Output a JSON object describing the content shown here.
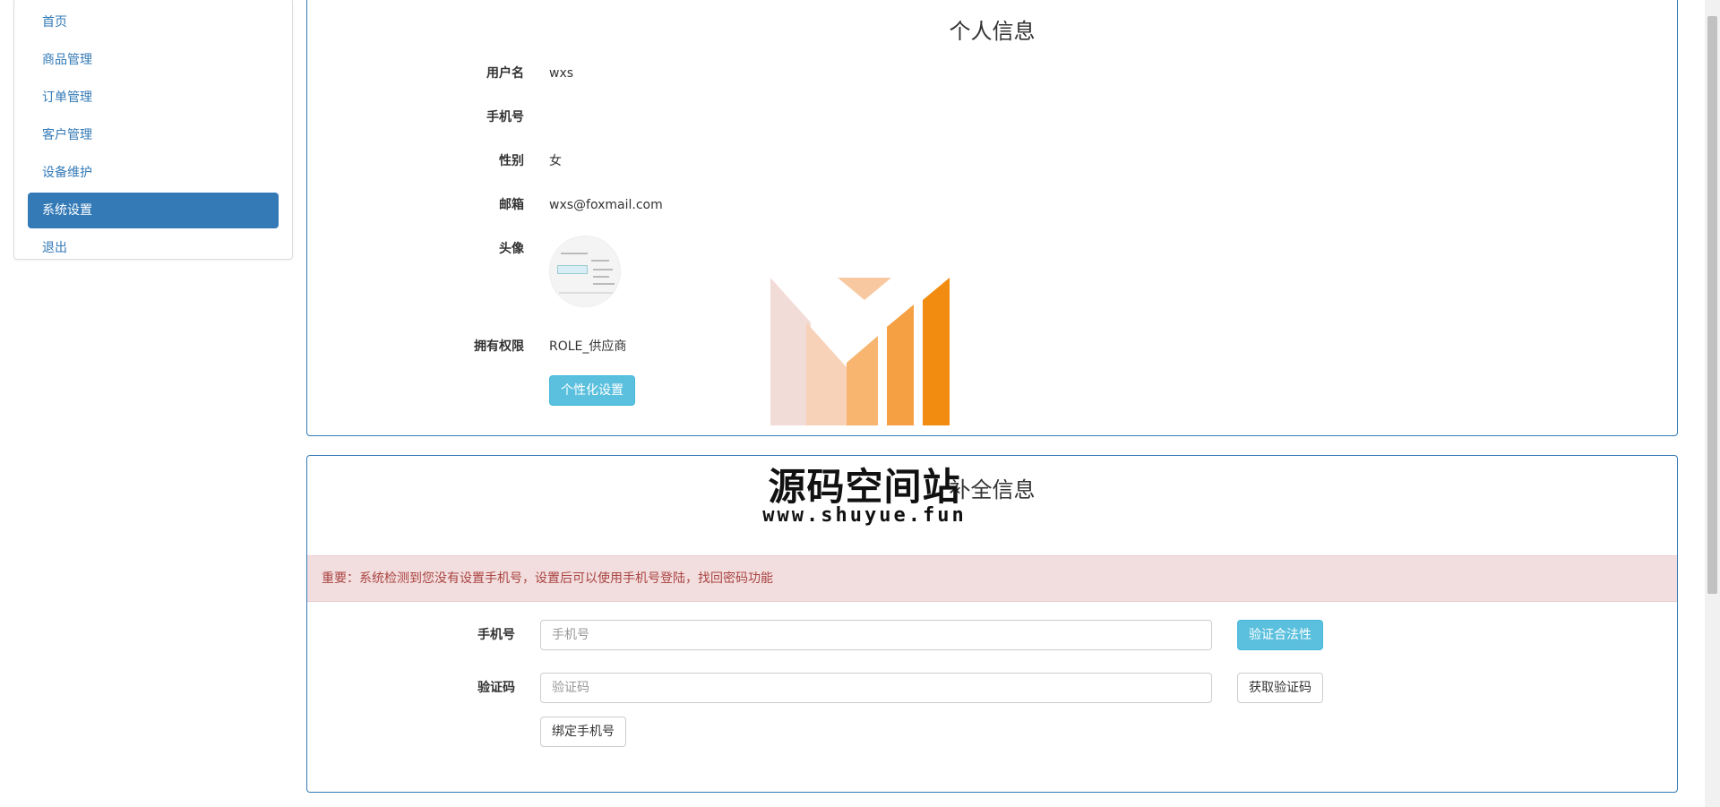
{
  "sidebar": {
    "items": [
      {
        "label": "首页",
        "active": false
      },
      {
        "label": "商品管理",
        "active": false
      },
      {
        "label": "订单管理",
        "active": false
      },
      {
        "label": "客户管理",
        "active": false
      },
      {
        "label": "设备维护",
        "active": false
      },
      {
        "label": "系统设置",
        "active": true
      },
      {
        "label": "退出",
        "active": false
      }
    ]
  },
  "profile": {
    "title": "个人信息",
    "username_label": "用户名",
    "username": "wxs",
    "phone_label": "手机号",
    "phone": "",
    "gender_label": "性别",
    "gender": "女",
    "email_label": "邮箱",
    "email": "wxs@foxmail.com",
    "avatar_label": "头像",
    "role_label": "拥有权限",
    "role": "ROLE_供应商",
    "personalize_button": "个性化设置"
  },
  "complete": {
    "title": "补全信息",
    "alert": "重要：系统检测到您没有设置手机号，设置后可以使用手机号登陆，找回密码功能",
    "phone_label": "手机号",
    "phone_placeholder": "手机号",
    "phone_value": "",
    "validate_button": "验证合法性",
    "code_label": "验证码",
    "code_placeholder": "验证码",
    "code_value": "",
    "get_code_button": "获取验证码",
    "bind_button": "绑定手机号"
  },
  "watermark": {
    "title": "源码空间站",
    "url": "www.shuyue.fun",
    "colors": [
      "#f2d9d4",
      "#f8c9a0",
      "#f5a043",
      "#f28c10"
    ]
  }
}
